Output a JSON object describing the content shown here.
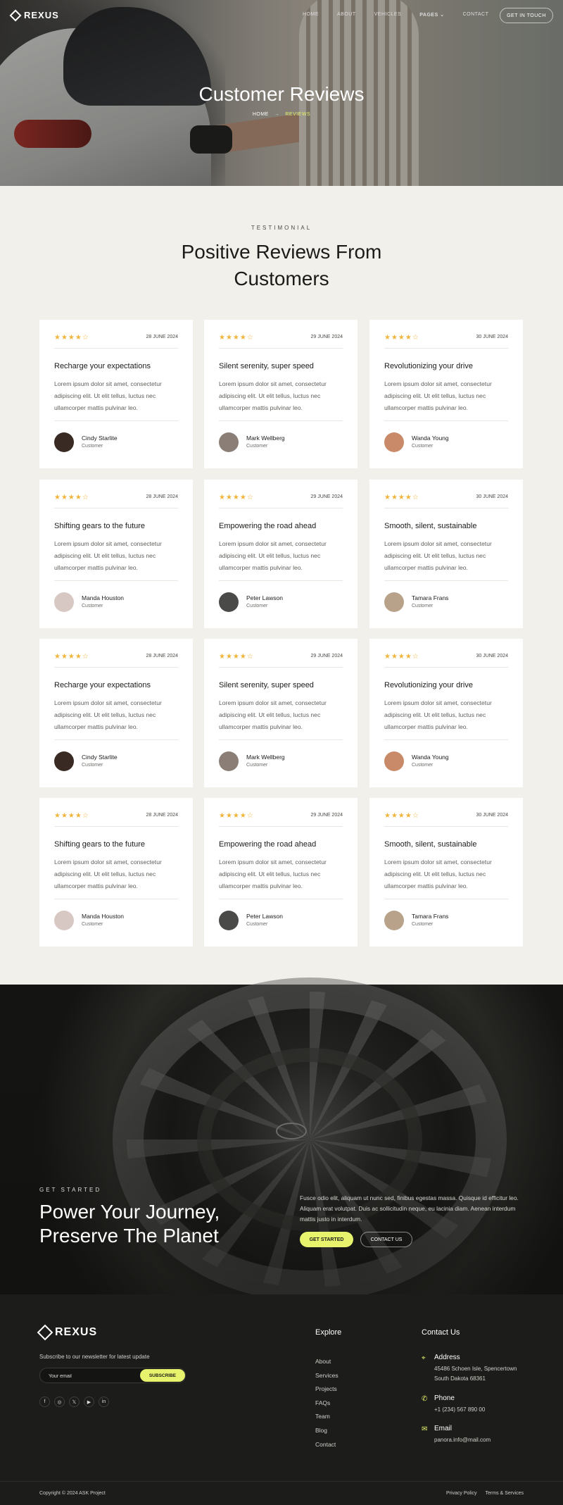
{
  "brand": {
    "name": "REXUS"
  },
  "nav": {
    "links": [
      "HOME",
      "ABOUT",
      "VEHICLES",
      "PAGES",
      "CONTACT"
    ],
    "pages_caret": "⌄",
    "cta": "GET IN TOUCH"
  },
  "hero": {
    "title": "Customer Reviews",
    "breadcrumb_home": "HOME",
    "breadcrumb_arrow": "→",
    "breadcrumb_current": "REVIEWS"
  },
  "reviews_section": {
    "eyebrow": "TESTIMONIAL",
    "title_line1": "Positive Reviews From",
    "title_line2": "Customers"
  },
  "reviews": [
    {
      "stars": "★★★★☆",
      "date": "28 JUNE 2024",
      "title": "Recharge your expectations",
      "body": "Lorem ipsum dolor sit amet, consectetur adipiscing elit. Ut elit tellus, luctus nec ullamcorper mattis pulvinar leo.",
      "name": "Cindy Starlite",
      "role": "Customer"
    },
    {
      "stars": "★★★★☆",
      "date": "29 JUNE 2024",
      "title": "Silent serenity, super speed",
      "body": "Lorem ipsum dolor sit amet, consectetur adipiscing elit. Ut elit tellus, luctus nec ullamcorper mattis pulvinar leo.",
      "name": "Mark Wellberg",
      "role": "Customer"
    },
    {
      "stars": "★★★★☆",
      "date": "30 JUNE 2024",
      "title": "Revolutionizing your drive",
      "body": "Lorem ipsum dolor sit amet, consectetur adipiscing elit. Ut elit tellus, luctus nec ullamcorper mattis pulvinar leo.",
      "name": "Wanda Young",
      "role": "Customer"
    },
    {
      "stars": "★★★★☆",
      "date": "28 JUNE 2024",
      "title": "Shifting gears to the future",
      "body": "Lorem ipsum dolor sit amet, consectetur adipiscing elit. Ut elit tellus, luctus nec ullamcorper mattis pulvinar leo.",
      "name": "Manda Houston",
      "role": "Customer"
    },
    {
      "stars": "★★★★☆",
      "date": "29 JUNE 2024",
      "title": "Empowering the road ahead",
      "body": "Lorem ipsum dolor sit amet, consectetur adipiscing elit. Ut elit tellus, luctus nec ullamcorper mattis pulvinar leo.",
      "name": "Peter Lawson",
      "role": "Customer"
    },
    {
      "stars": "★★★★☆",
      "date": "30 JUNE 2024",
      "title": "Smooth, silent, sustainable",
      "body": "Lorem ipsum dolor sit amet, consectetur adipiscing elit. Ut elit tellus, luctus nec ullamcorper mattis pulvinar leo.",
      "name": "Tamara Frans",
      "role": "Customer"
    },
    {
      "stars": "★★★★☆",
      "date": "28 JUNE 2024",
      "title": "Recharge your expectations",
      "body": "Lorem ipsum dolor sit amet, consectetur adipiscing elit. Ut elit tellus, luctus nec ullamcorper mattis pulvinar leo.",
      "name": "Cindy Starlite",
      "role": "Customer"
    },
    {
      "stars": "★★★★☆",
      "date": "29 JUNE 2024",
      "title": "Silent serenity, super speed",
      "body": "Lorem ipsum dolor sit amet, consectetur adipiscing elit. Ut elit tellus, luctus nec ullamcorper mattis pulvinar leo.",
      "name": "Mark Wellberg",
      "role": "Customer"
    },
    {
      "stars": "★★★★☆",
      "date": "30 JUNE 2024",
      "title": "Revolutionizing your drive",
      "body": "Lorem ipsum dolor sit amet, consectetur adipiscing elit. Ut elit tellus, luctus nec ullamcorper mattis pulvinar leo.",
      "name": "Wanda Young",
      "role": "Customer"
    },
    {
      "stars": "★★★★☆",
      "date": "28 JUNE 2024",
      "title": "Shifting gears to the future",
      "body": "Lorem ipsum dolor sit amet, consectetur adipiscing elit. Ut elit tellus, luctus nec ullamcorper mattis pulvinar leo.",
      "name": "Manda Houston",
      "role": "Customer"
    },
    {
      "stars": "★★★★☆",
      "date": "29 JUNE 2024",
      "title": "Empowering the road ahead",
      "body": "Lorem ipsum dolor sit amet, consectetur adipiscing elit. Ut elit tellus, luctus nec ullamcorper mattis pulvinar leo.",
      "name": "Peter Lawson",
      "role": "Customer"
    },
    {
      "stars": "★★★★☆",
      "date": "30 JUNE 2024",
      "title": "Smooth, silent, sustainable",
      "body": "Lorem ipsum dolor sit amet, consectetur adipiscing elit. Ut elit tellus, luctus nec ullamcorper mattis pulvinar leo.",
      "name": "Tamara Frans",
      "role": "Customer"
    }
  ],
  "avatar_colors": [
    "#3a2a24",
    "#8a7e76",
    "#c98a6a",
    "#d8c8c4",
    "#4a4a48",
    "#b8a38a"
  ],
  "cta": {
    "eyebrow": "GET STARTED",
    "title_line1": "Power Your Journey,",
    "title_line2": "Preserve The Planet",
    "text": "Fusce odio elit, aliquam ut nunc sed, finibus egestas massa. Quisque id efficitur leo. Aliquam erat volutpat. Duis ac sollicitudin neque, eu lacinia diam. Aenean interdum mattis justo in interdum.",
    "primary": "GET STARTED",
    "secondary": "CONTACT US"
  },
  "footer": {
    "subscribe_text": "Subscribe to our newsletter for latest update",
    "email_placeholder": "Your email",
    "subscribe_button": "SUBSCRIBE",
    "socials": [
      "f",
      "◎",
      "𝕏",
      "▶",
      "in"
    ],
    "explore_heading": "Explore",
    "explore_links": [
      "About",
      "Services",
      "Projects",
      "FAQs",
      "Team",
      "Blog",
      "Contact"
    ],
    "contact_heading": "Contact Us",
    "address_label": "Address",
    "address_value": "45486 Schoen Isle, Spencertown South Dakota 68361",
    "phone_label": "Phone",
    "phone_value": "+1 (234) 567 890 00",
    "email_label": "Email",
    "email_value": "panora.info@mail.com",
    "copyright": "Copyright © 2024 ASK Project",
    "privacy": "Privacy Policy",
    "terms": "Terms & Services"
  },
  "colors": {
    "accent": "#e7f36c",
    "star": "#f1b43a",
    "dark": "#1c1c1a",
    "bg": "#f2f0ea"
  }
}
